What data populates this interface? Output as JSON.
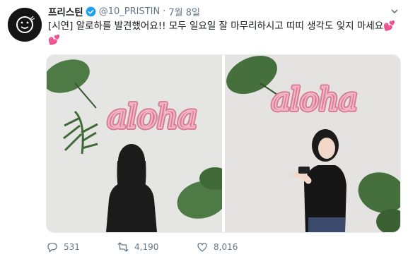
{
  "account": {
    "name": "프리스틴",
    "handle": "@10_PRISTIN",
    "separator": "·",
    "time": "7월 8일",
    "verified": true
  },
  "tweet": {
    "text": "[시연] 알로하를 발견했어요!! 모두 일요일 잘 마무리하시고 띠띠 생각도 잊지 마세요",
    "emoji": "💕💕"
  },
  "media": {
    "photos": [
      {
        "sign_text": "aloha"
      },
      {
        "sign_text": "aloha"
      }
    ]
  },
  "actions": {
    "replies": "531",
    "retweets": "4,190",
    "likes": "8,016"
  },
  "colors": {
    "text": "#14171a",
    "muted": "#657786",
    "verified_blue": "#1da1f2",
    "balloon_pink": "#d97d95",
    "leaf_green": "#3e6a3a"
  },
  "icons": [
    "avatar-smiley-icon",
    "verified-badge-icon",
    "chevron-down-icon",
    "reply-icon",
    "retweet-icon",
    "like-icon"
  ]
}
